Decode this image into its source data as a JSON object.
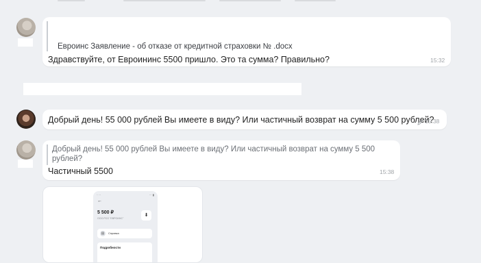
{
  "messages": [
    {
      "attachment_name": "Евроинс Заявление - об отказе от кредитной страховки №             .docx",
      "text": "Здравствуйте, от Евроининс 5500 пришло. Это та сумма? Правильно?",
      "time": "15:32"
    },
    {
      "text": "Добрый день! 55 000 рублей Вы имеете в виду? Или частичный возврат на сумму 5 500 рублей?",
      "time": "15:38",
      "edited_icon": "pencil-icon"
    },
    {
      "quote": "Добрый день! 55 000 рублей Вы имеете в виду? Или частичный возврат на сумму 5 500 рублей?",
      "text": "Частичный 5500",
      "time": "15:38"
    }
  ],
  "phone_screenshot": {
    "amount": "5 500 ₽",
    "company": "ООО РСО \"ЕВРОИНС\"",
    "reference_label": "Справка",
    "details_label": "Подробности",
    "back_icon": "arrow-left-icon",
    "download_icon": "download-icon"
  }
}
